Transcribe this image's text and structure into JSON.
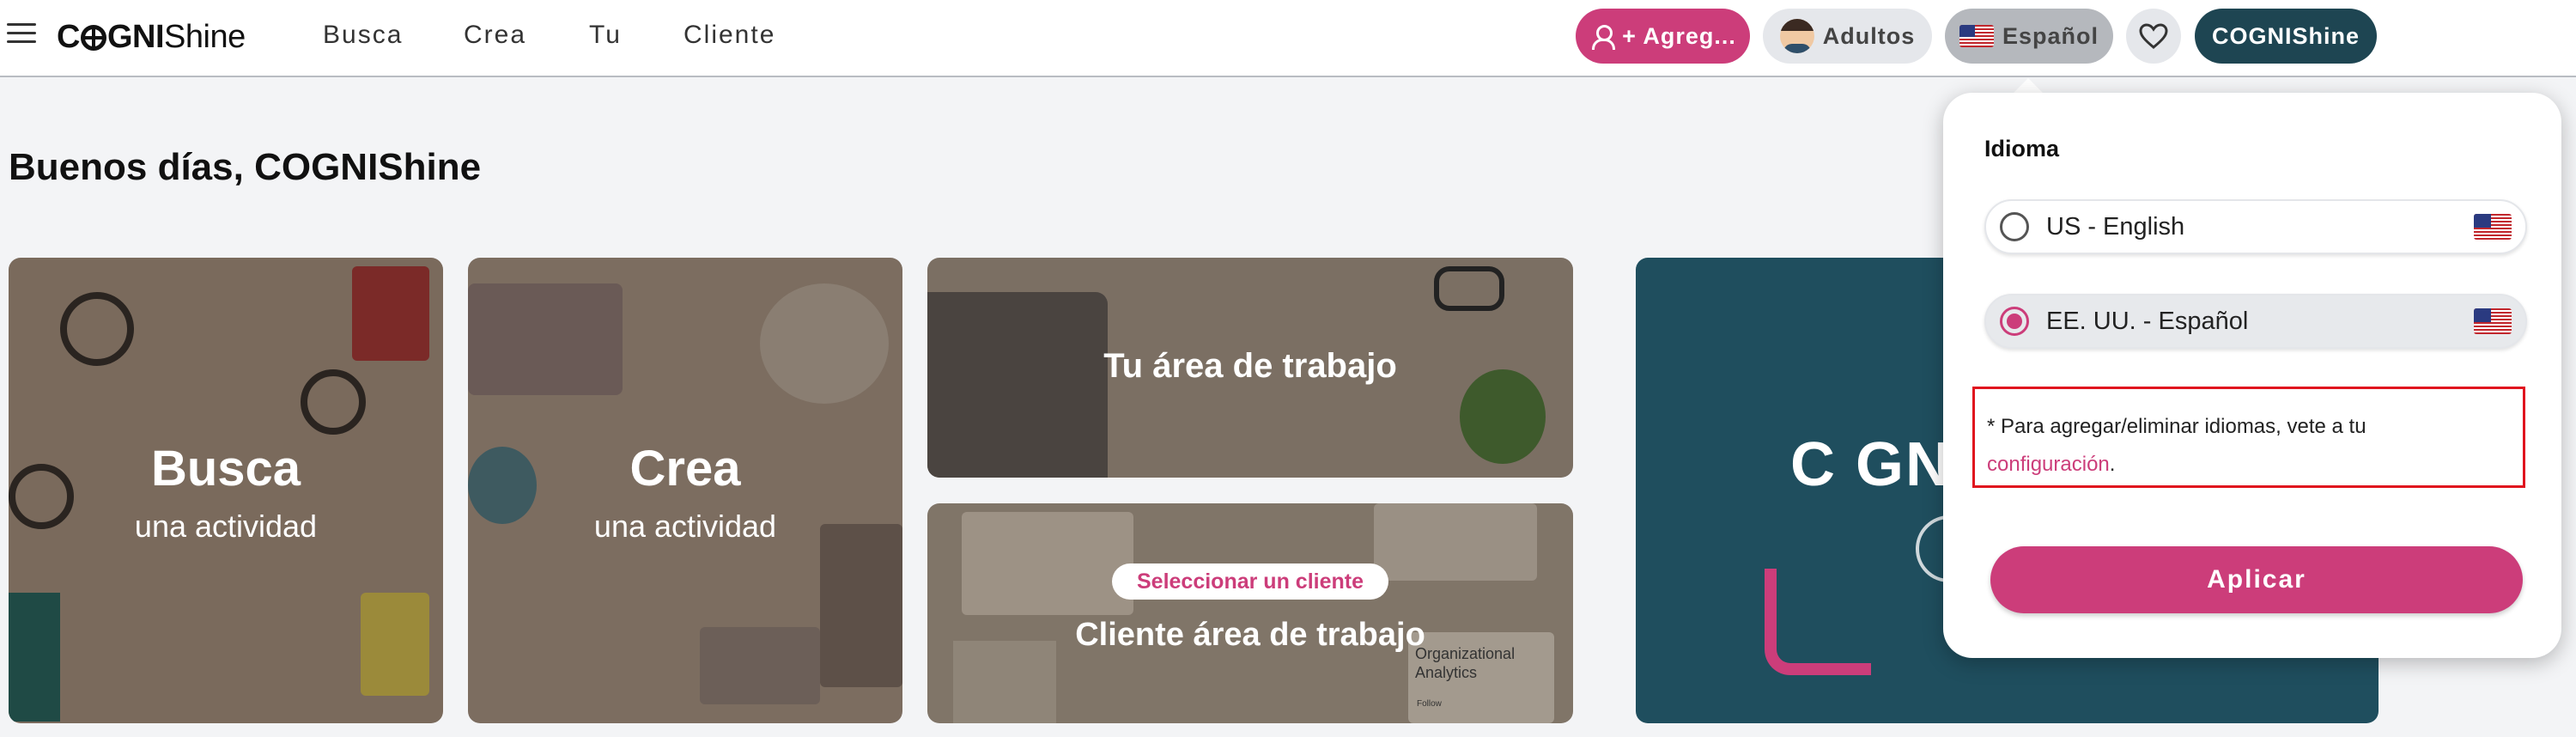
{
  "brand": {
    "logo_bold": "C",
    "logo_bold2": "GNI",
    "logo_light": "Shine"
  },
  "nav": {
    "items": [
      "Busca",
      "Crea",
      "Tu",
      "Cliente"
    ]
  },
  "header": {
    "add_label": "+ Agreg...",
    "audience_label": "Adultos",
    "language_label": "Español",
    "user_label": "COGNIShine"
  },
  "main": {
    "greeting": "Buenos días, COGNIShine",
    "cards": {
      "busca": {
        "title": "Busca",
        "sub": "una actividad"
      },
      "crea": {
        "title": "Crea",
        "sub": "una actividad"
      },
      "tu": {
        "title": "Tu área de trabajo"
      },
      "cliente": {
        "badge": "Seleccionar un cliente",
        "title": "Cliente área de trabajo",
        "chart_text": "Organizational Analytics",
        "chart_foot": "Follow"
      }
    },
    "promo_text": "C GN"
  },
  "language_panel": {
    "title": "Idioma",
    "options": [
      {
        "label": "US - English",
        "selected": false
      },
      {
        "label": "EE. UU. - Español",
        "selected": true
      }
    ],
    "note_prefix": "* Para agregar/eliminar idiomas, vete a tu",
    "note_link": "configuración",
    "note_suffix": ".",
    "apply_label": "Aplicar"
  },
  "colors": {
    "accent": "#cc3d7a",
    "brand_dark": "#1e4552",
    "highlight_border": "#e0141e"
  },
  "icons": [
    "menu-icon",
    "user-icon",
    "avatar-icon",
    "us-flag-icon",
    "heart-icon"
  ]
}
